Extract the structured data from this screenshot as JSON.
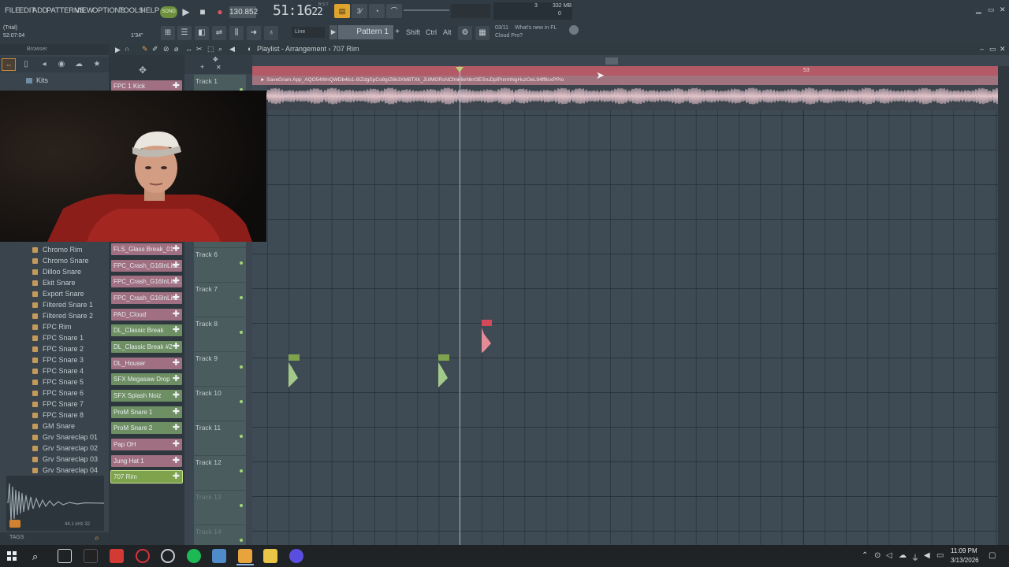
{
  "menu": [
    "FILE",
    "EDIT",
    "ADD",
    "PATTERNS",
    "VIEW",
    "OPTIONS",
    "TOOLS",
    "HELP"
  ],
  "transport": {
    "song_mode": "SONG",
    "bpm": "130.852",
    "time": "51:16",
    "time_ms": "22",
    "time_sub": "B:S:T",
    "cpu_val": "3",
    "mem": "332 MB",
    "voices": "0"
  },
  "toolbar2": {
    "trial": "(Trial)",
    "elapsed": "52:07:04",
    "elapsed2": "1'34\"",
    "snap": "Line",
    "pattern": "Pattern 1",
    "shift": "Shift",
    "ctrl": "Ctrl",
    "alt": "Alt",
    "news_date": "03/11",
    "news_text_1": "What's new in FL",
    "news_text_2": "Cloud Pro?"
  },
  "browser": {
    "title": "Browser",
    "kits": "Kits",
    "items": [
      "Chromo Rim",
      "Chromo Snare",
      "Dilloo Snare",
      "Ekit Snare",
      "Export Snare",
      "Filtered Snare 1",
      "Filtered Snare 2",
      "FPC Rim",
      "FPC Snare 1",
      "FPC Snare 2",
      "FPC Snare 3",
      "FPC Snare 4",
      "FPC Snare 5",
      "FPC Snare 6",
      "FPC Snare 7",
      "FPC Snare 8",
      "GM Snare",
      "Grv Snareclap 01",
      "Grv Snareclap 02",
      "Grv Snareclap 03",
      "Grv Snareclap 04"
    ],
    "sample_info": "44.1 kHz 32",
    "tags": "TAGS"
  },
  "channels": [
    {
      "name": "FPC 1 Kick",
      "color": "pink"
    },
    {
      "name": "FLS_Glass Break_01",
      "color": "pink"
    },
    {
      "name": "FPC_Crash_G16InLite..",
      "color": "pink"
    },
    {
      "name": "FPC_Crash_G16InLite..",
      "color": "pink"
    },
    {
      "name": "FPC_Crash_G16InLite..",
      "color": "pink"
    },
    {
      "name": "PAD_Cloud",
      "color": "pink"
    },
    {
      "name": "DL_Classic Break",
      "color": "green"
    },
    {
      "name": "DL_Classic Break #2",
      "color": "green"
    },
    {
      "name": "DL_Houser",
      "color": "pink"
    },
    {
      "name": "SFX Megasaw Drop",
      "color": "green"
    },
    {
      "name": "SFX Splash Noiz",
      "color": "green"
    },
    {
      "name": "ProM Snare 1",
      "color": "green"
    },
    {
      "name": "ProM Snare 2",
      "color": "green"
    },
    {
      "name": "Pap OH",
      "color": "pink"
    },
    {
      "name": "Jung Hat 1",
      "color": "pink"
    },
    {
      "name": "707 Rim",
      "color": "selected"
    }
  ],
  "playlist": {
    "title": "Playlist - Arrangement › 707 Rim",
    "bar_marker": "53",
    "audio_clip_name": "► SaveGram.App_AQO54WnQWDb4lo1-8IZdgSpCo8gIZ6k3XM8TXk_JUlMGRsNCfmk6eNkrt3ESruDplPnmhNgHuzOeL94ff8cxPPIo",
    "tracks": [
      "Track 1",
      "Track 6",
      "Track 7",
      "Track 8",
      "Track 9",
      "Track 10",
      "Track 11",
      "Track 12",
      "Track 13",
      "Track 14"
    ]
  },
  "taskbar": {
    "time": "11:09 PM",
    "date": "3/13/2026"
  },
  "colors": {
    "accent_pink": "#b35a66",
    "clip_green": "#7fa34d",
    "clip_red": "#d24a5a"
  }
}
